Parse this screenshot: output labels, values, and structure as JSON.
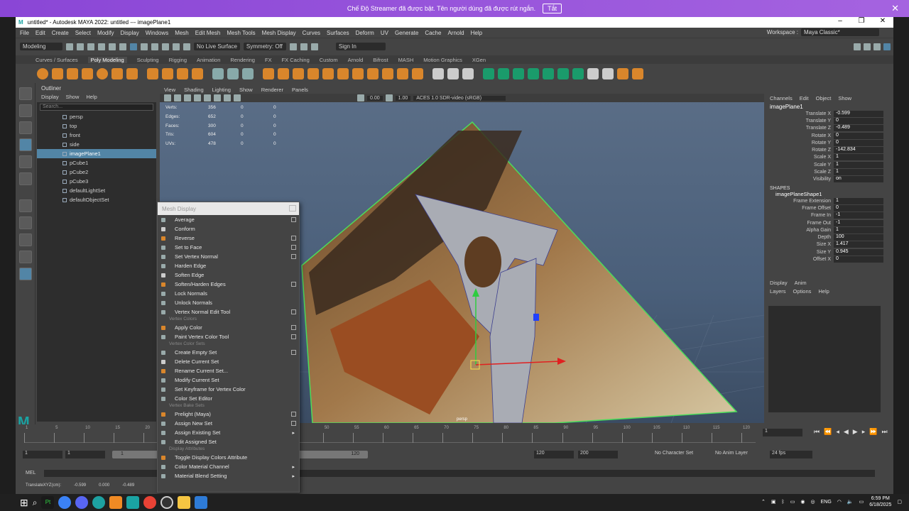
{
  "banner": {
    "text": "Chế Độ Streamer đã được bật. Tên người dùng đã được rút ngắn.",
    "button": "Tắt"
  },
  "window": {
    "title": "untitled* - Autodesk MAYA 2022: untitled  ---  imagePlane1"
  },
  "menubar": [
    "File",
    "Edit",
    "Create",
    "Select",
    "Modify",
    "Display",
    "Windows",
    "Mesh",
    "Edit Mesh",
    "Mesh Tools",
    "Mesh Display",
    "Curves",
    "Surfaces",
    "Deform",
    "UV",
    "Generate",
    "Cache",
    "Arnold",
    "Help"
  ],
  "workspace": {
    "label": "Workspace :",
    "value": "Maya Classic*"
  },
  "statusline": {
    "mode": "Modeling",
    "live_surface": "No Live Surface",
    "symmetry": "Symmetry: Off",
    "signin": "Sign In"
  },
  "shelftabs": [
    "Curves / Surfaces",
    "Poly Modeling",
    "Sculpting",
    "Rigging",
    "Animation",
    "Rendering",
    "FX",
    "FX Caching",
    "Custom",
    "Arnold",
    "Bifrost",
    "MASH",
    "Motion Graphics",
    "XGen"
  ],
  "shelf_active": "Poly Modeling",
  "outliner": {
    "title": "Outliner",
    "menu": [
      "Display",
      "Show",
      "Help"
    ],
    "search_placeholder": "Search...",
    "items": [
      "persp",
      "top",
      "front",
      "side",
      "imagePlane1",
      "pCube1",
      "pCube2",
      "pCube3",
      "defaultLightSet",
      "defaultObjectSet"
    ],
    "selected": "imagePlane1"
  },
  "viewport": {
    "menu": [
      "View",
      "Shading",
      "Lighting",
      "Show",
      "Renderer",
      "Panels"
    ],
    "exposure": "0.00",
    "gamma": "1.00",
    "colorspace": "ACES 1.0 SDR-video (sRGB)",
    "camera_label": "persp",
    "hud": [
      {
        "k": "Verts:",
        "a": "356",
        "b": "0",
        "c": "0"
      },
      {
        "k": "Edges:",
        "a": "652",
        "b": "0",
        "c": "0"
      },
      {
        "k": "Faces:",
        "a": "300",
        "b": "0",
        "c": "0"
      },
      {
        "k": "Tris:",
        "a": "604",
        "b": "0",
        "c": "0"
      },
      {
        "k": "UVs:",
        "a": "478",
        "b": "0",
        "c": "0"
      }
    ]
  },
  "channelbox": {
    "tabs": [
      "Channels",
      "Edit",
      "Object",
      "Show"
    ],
    "object": "imagePlane1",
    "attrs": [
      {
        "k": "Translate X",
        "v": "-0.599"
      },
      {
        "k": "Translate Y",
        "v": "0"
      },
      {
        "k": "Translate Z",
        "v": "-0.489"
      },
      {
        "k": "Rotate X",
        "v": "0"
      },
      {
        "k": "Rotate Y",
        "v": "0"
      },
      {
        "k": "Rotate Z",
        "v": "-142.834"
      },
      {
        "k": "Scale X",
        "v": "1"
      },
      {
        "k": "Scale Y",
        "v": "1"
      },
      {
        "k": "Scale Z",
        "v": "1"
      },
      {
        "k": "Visibility",
        "v": "on"
      }
    ],
    "shapes_header": "SHAPES",
    "shape_name": "imagePlaneShape1",
    "shape_attrs": [
      {
        "k": "Frame Extension",
        "v": "1"
      },
      {
        "k": "Frame Offset",
        "v": "0"
      },
      {
        "k": "Frame In",
        "v": "-1"
      },
      {
        "k": "Frame Out",
        "v": "-1"
      },
      {
        "k": "Alpha Gain",
        "v": "1"
      },
      {
        "k": "Depth",
        "v": "100"
      },
      {
        "k": "Size X",
        "v": "1.417"
      },
      {
        "k": "Size Y",
        "v": "0.945"
      },
      {
        "k": "Offset X",
        "v": "0"
      }
    ]
  },
  "layers": {
    "tabs": [
      "Display",
      "Anim"
    ],
    "menu": [
      "Layers",
      "Options",
      "Help"
    ]
  },
  "timeline": {
    "ticks": [
      "1",
      "5",
      "10",
      "15",
      "20",
      "25",
      "30",
      "35",
      "40",
      "45",
      "50",
      "55",
      "60",
      "65",
      "70",
      "75",
      "80",
      "85",
      "90",
      "95",
      "100",
      "105",
      "110",
      "115",
      "120"
    ],
    "current_frame": "1"
  },
  "range": {
    "start": "1",
    "start2": "1",
    "slider_start": "1",
    "slider_end": "120",
    "end": "120",
    "end2": "200",
    "character": "No Character Set",
    "anim_layer": "No Anim Layer",
    "fps": "24 fps"
  },
  "cmd": {
    "label": "MEL"
  },
  "help_line": {
    "label": "TranslateXYZ(cm):",
    "x": "-0.599",
    "y": "0.000",
    "z": "-0.489"
  },
  "popup": {
    "title": "Mesh Display",
    "entries": [
      {
        "t": "item",
        "label": "Average",
        "box": true
      },
      {
        "t": "item",
        "label": "Conform",
        "box": false
      },
      {
        "t": "item",
        "label": "Reverse",
        "box": true
      },
      {
        "t": "item",
        "label": "Set to Face",
        "box": true
      },
      {
        "t": "item",
        "label": "Set Vertex Normal",
        "box": true
      },
      {
        "t": "item",
        "label": "Harden Edge",
        "box": false
      },
      {
        "t": "item",
        "label": "Soften Edge",
        "box": false
      },
      {
        "t": "item",
        "label": "Soften/Harden Edges",
        "box": true
      },
      {
        "t": "item",
        "label": "Lock Normals",
        "box": false
      },
      {
        "t": "item",
        "label": "Unlock Normals",
        "box": false
      },
      {
        "t": "item",
        "label": "Vertex Normal Edit Tool",
        "box": true
      },
      {
        "t": "cat",
        "label": "Vertex Colors"
      },
      {
        "t": "item",
        "label": "Apply Color",
        "box": true
      },
      {
        "t": "item",
        "label": "Paint Vertex Color Tool",
        "box": true
      },
      {
        "t": "cat",
        "label": "Vertex Color Sets"
      },
      {
        "t": "item",
        "label": "Create Empty Set",
        "box": true
      },
      {
        "t": "item",
        "label": "Delete Current Set",
        "box": false
      },
      {
        "t": "item",
        "label": "Rename Current Set...",
        "box": false
      },
      {
        "t": "item",
        "label": "Modify Current Set",
        "box": false
      },
      {
        "t": "item",
        "label": "Set Keyframe for Vertex Color",
        "box": false
      },
      {
        "t": "item",
        "label": "Color Set Editor",
        "box": false
      },
      {
        "t": "cat",
        "label": "Vertex Bake Sets"
      },
      {
        "t": "item",
        "label": "Prelight (Maya)",
        "box": true
      },
      {
        "t": "item",
        "label": "Assign New Set",
        "box": true
      },
      {
        "t": "item",
        "label": "Assign Existing Set",
        "arrow": true
      },
      {
        "t": "item",
        "label": "Edit Assigned Set",
        "box": false
      },
      {
        "t": "cat",
        "label": "Display Attributes"
      },
      {
        "t": "item",
        "label": "Toggle Display Colors Attribute",
        "box": false
      },
      {
        "t": "item",
        "label": "Color Material Channel",
        "arrow": true
      },
      {
        "t": "item",
        "label": "Material Blend Setting",
        "arrow": true
      }
    ]
  },
  "taskbar": {
    "lang": "ENG",
    "time": "6:59 PM",
    "date": "6/18/2025"
  },
  "colors": {
    "selection": "#5285a6",
    "banner": "#9b57de",
    "gizmo_y": "#2ecc40",
    "gizmo_x": "#e02020",
    "gizmo_z": "#2040ff"
  }
}
